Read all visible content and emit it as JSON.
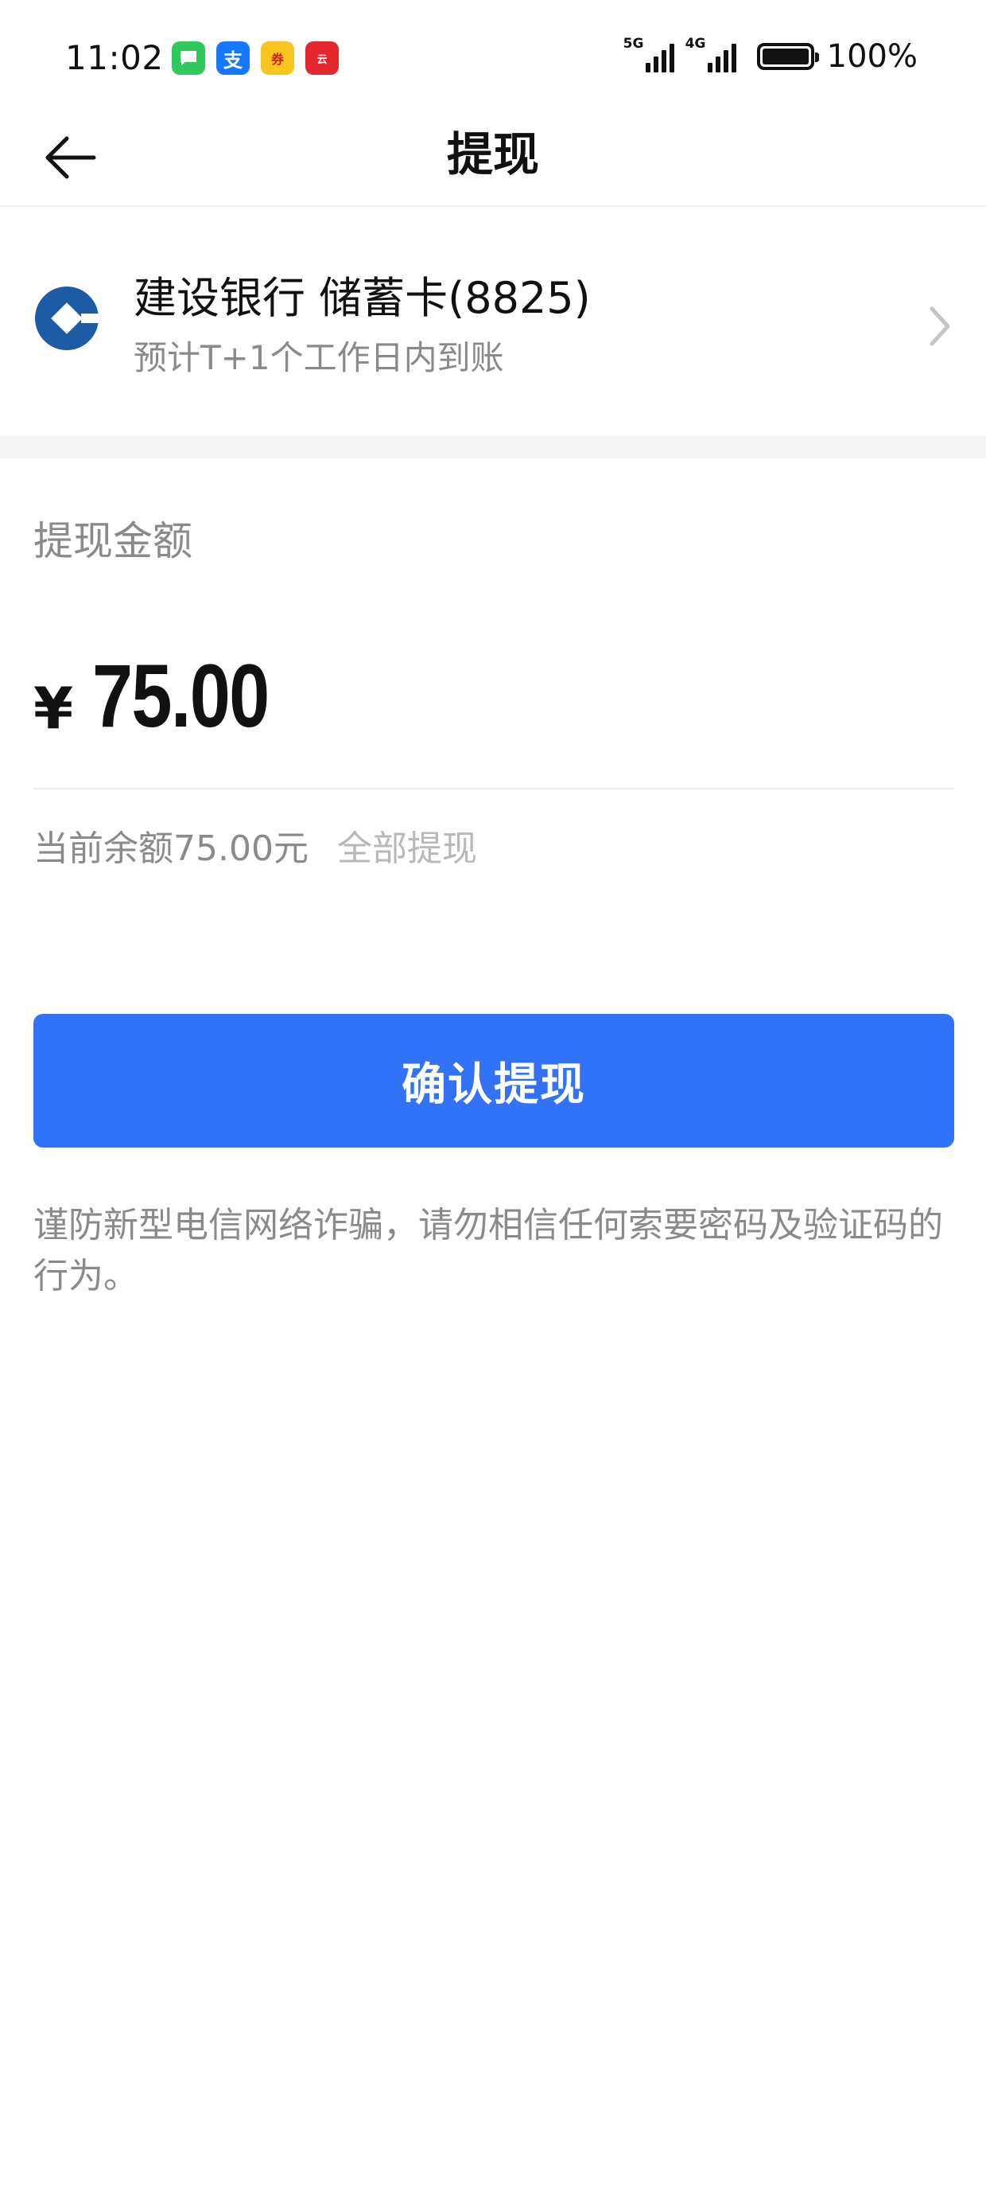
{
  "status_bar": {
    "time": "11:02",
    "notification_icons": [
      "messages-icon",
      "alipay-icon",
      "coupon-icon",
      "unionpay-icon"
    ],
    "network_1": "5G",
    "network_2": "4G",
    "battery": "100%",
    "battery_level": 1.0
  },
  "nav": {
    "title": "提现"
  },
  "bank": {
    "name": "建设银行 储蓄卡(8825)",
    "eta": "预计T+1个工作日内到账"
  },
  "amount": {
    "label": "提现金额",
    "currency": "¥",
    "value": "75.00",
    "balance": "当前余额75.00元",
    "withdraw_all": "全部提现"
  },
  "confirm": {
    "label": "确认提现"
  },
  "warning": "谨防新型电信网络诈骗，请勿相信任何索要密码及验证码的行为。",
  "colors": {
    "accent": "#3272f6",
    "bank_brand": "#1d5ba6",
    "muted_text": "#8a8a8a"
  }
}
